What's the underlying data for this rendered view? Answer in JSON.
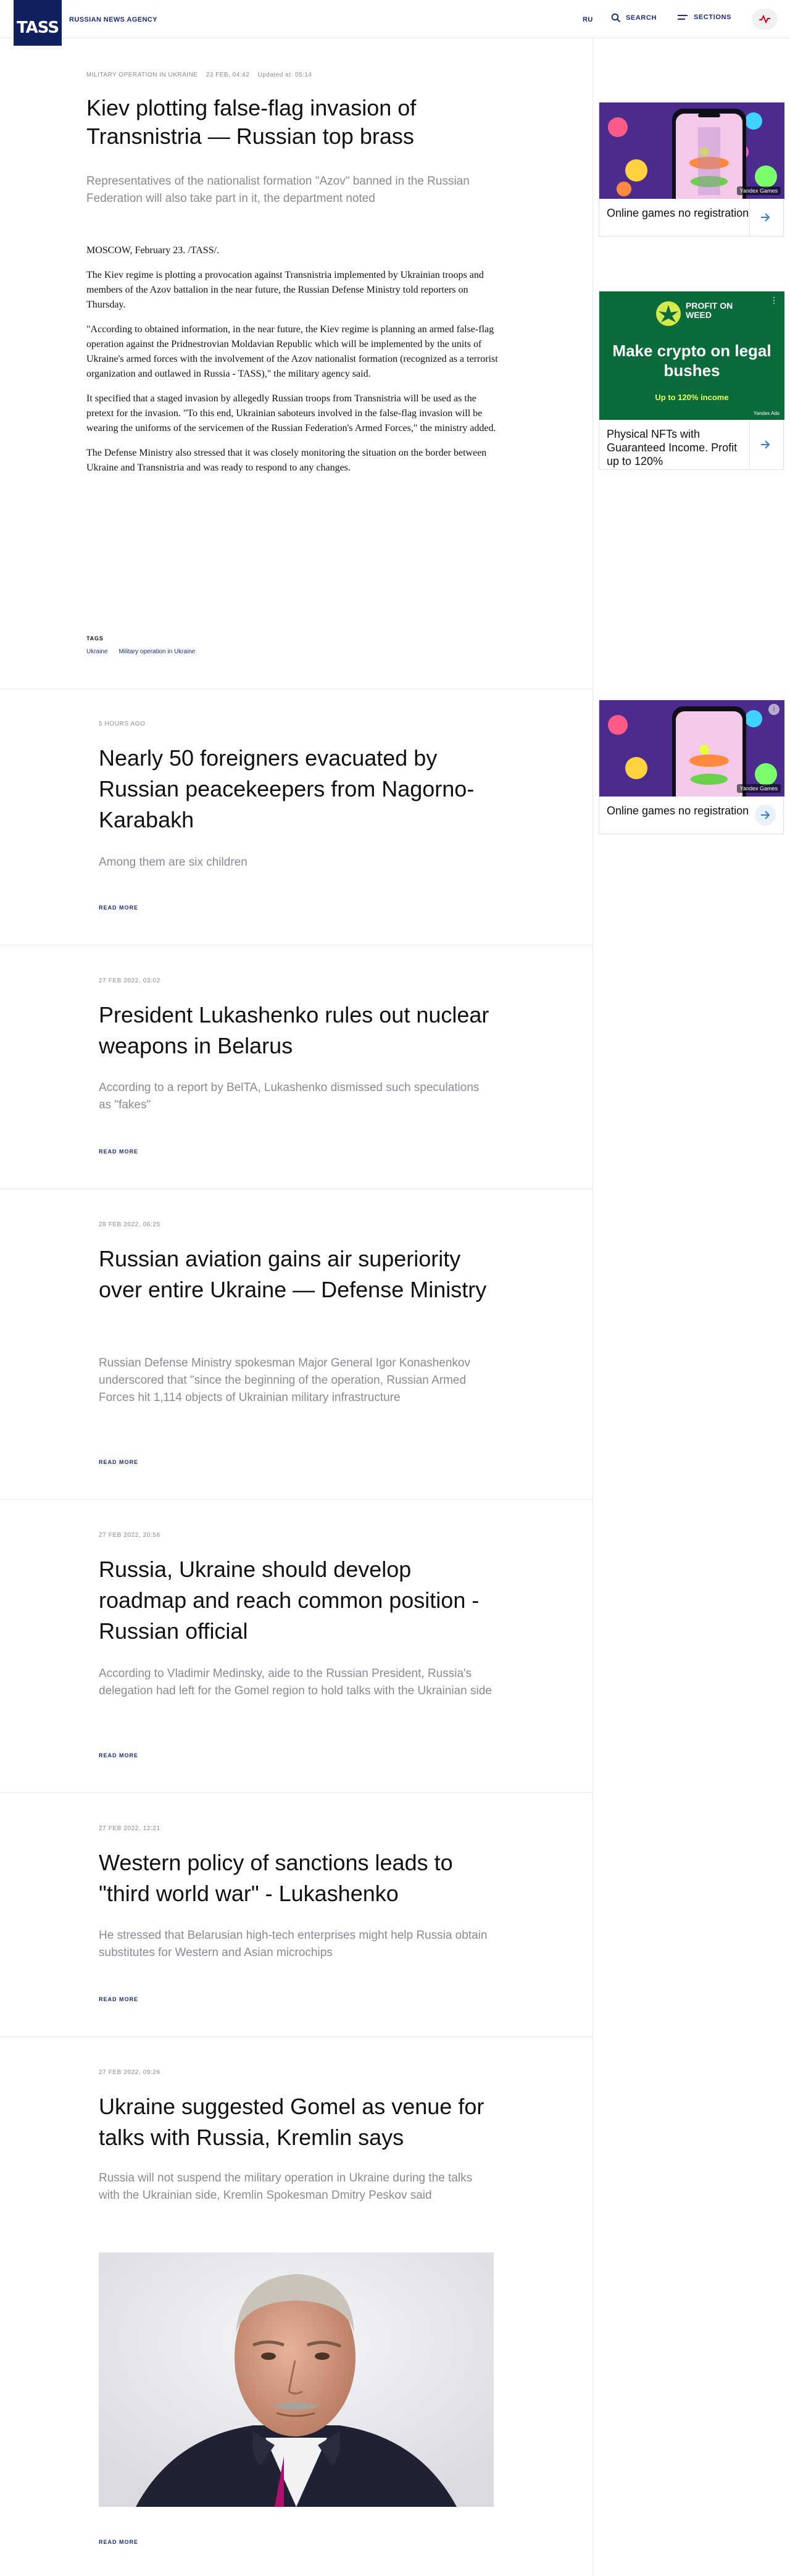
{
  "header": {
    "logo": "TASS",
    "agency": "RUSSIAN NEWS AGENCY",
    "lang": "RU",
    "search": "SEARCH",
    "sections": "SECTIONS"
  },
  "article": {
    "category": "MILITARY OPERATION IN UKRAINE",
    "date": "23 FEB, 04:42",
    "updated": "Updated at: 05:14",
    "title": "Kiev plotting false-flag invasion of Transnistria — Russian top brass",
    "lead": "Representatives of the nationalist formation \"Azov\" banned in the Russian Federation will also take part in it, the department noted",
    "paragraphs": [
      "MOSCOW, February 23. /TASS/.",
      "The Kiev regime is plotting a provocation against Transnistria implemented by Ukrainian troops and members of the Azov battalion in the near future, the Russian Defense Ministry told reporters on Thursday.",
      "\"According to obtained information, in the near future, the Kiev regime is planning an armed false-flag operation against the Pridnestrovian Moldavian Republic which will be implemented by the units of Ukraine's armed forces with the involvement of the Azov nationalist formation (recognized as a terrorist organization and outlawed in Russia - TASS),\" the military agency said.",
      "It specified that a staged invasion by allegedly Russian troops from Transnistria will be used as the pretext for the invasion. \"To this end, Ukrainian saboteurs involved in the false-flag invasion will be wearing the uniforms of the servicemen of the Russian Federation's Armed Forces,\" the ministry added.",
      "The Defense Ministry also stressed that it was closely monitoring the situation on the border between Ukraine and Transnistria and was ready to respond to any changes."
    ],
    "tags_label": "TAGS",
    "tags": [
      "Ukraine",
      "Military operation in Ukraine"
    ]
  },
  "news": [
    {
      "date": "5 HOURS AGO",
      "title": "Nearly 50 foreigners evacuated by Russian peacekeepers from Nagorno-Karabakh",
      "lead": "Among them are six children",
      "read_more": "READ MORE"
    },
    {
      "date": "27 FEB 2022, 03:02",
      "title": "President Lukashenko rules out nuclear weapons in Belarus",
      "lead": "According to a report by BelTA, Lukashenko dismissed such speculations as \"fakes\"",
      "read_more": "READ MORE"
    },
    {
      "date": "28 FEB 2022, 06:25",
      "title": "Russian aviation gains air superiority over entire Ukraine — Defense Ministry",
      "lead": "Russian Defense Ministry spokesman Major General Igor Konashenkov underscored that \"since the beginning of the operation, Russian Armed Forces hit 1,114 objects of Ukrainian military infrastructure",
      "read_more": "READ MORE"
    },
    {
      "date": "27 FEB 2022, 20:56",
      "title": "Russia, Ukraine should develop roadmap and reach common position - Russian official",
      "lead": "According to Vladimir Medinsky, aide to the Russian President, Russia's delegation had left for the Gomel region to hold talks with the Ukrainian side",
      "read_more": "READ MORE"
    },
    {
      "date": "27 FEB 2022, 12:21",
      "title": "Western policy of sanctions leads to \"third world war\" - Lukashenko",
      "lead": "He stressed that Belarusian high-tech enterprises might help Russia obtain substitutes for Western and Asian microchips",
      "read_more": "READ MORE"
    },
    {
      "date": "27 FEB 2022, 09:26",
      "title": "Ukraine suggested Gomel as venue for talks with Russia, Kremlin says",
      "lead": "Russia will not suspend the military operation in Ukraine during the talks with the Ukrainian side, Kremlin Spokesman Dmitry Peskov said",
      "read_more": "READ MORE"
    }
  ],
  "ads": [
    {
      "title": "Online games no registration",
      "badge": "Yandex Games"
    },
    {
      "title": "Physical NFTs with Guaranteed Income. Profit up to 120%",
      "headline": "Make crypto on legal bushes",
      "sub": "Up to 120% income",
      "logo": "PROFIT ON WEED",
      "badge": "Yandex Ads"
    },
    {
      "title": "Online games no registration",
      "badge": "Yandex Games"
    }
  ],
  "colors": {
    "brand": "#11215d",
    "link": "#1c2c7e",
    "muted": "#8a8a94"
  }
}
